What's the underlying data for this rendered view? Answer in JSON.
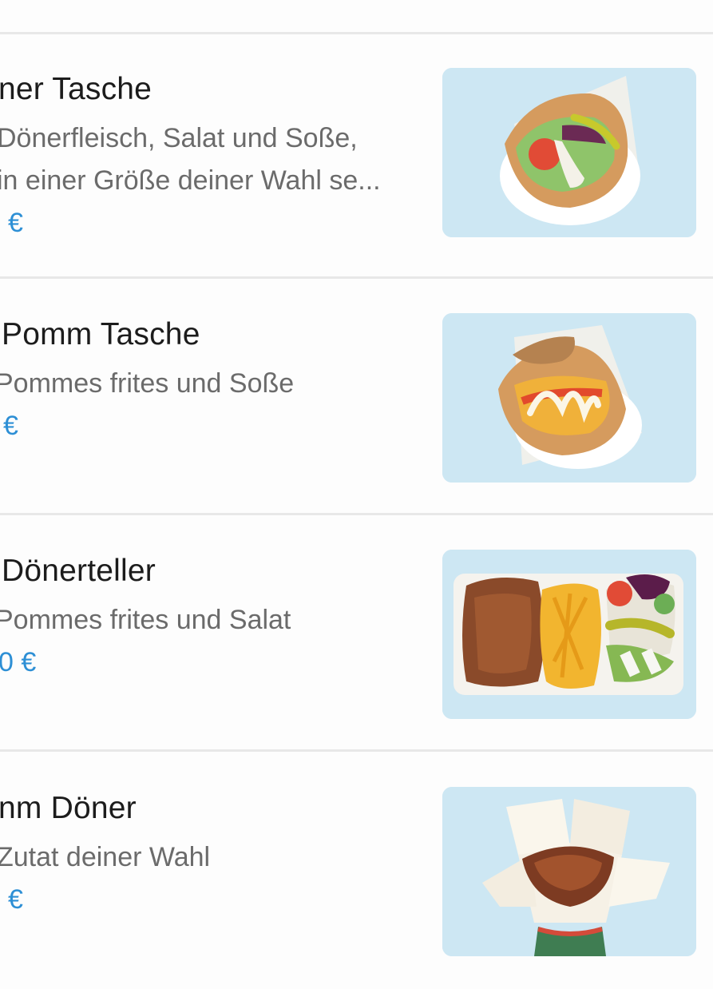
{
  "items": [
    {
      "title": "ner Tasche",
      "desc_line1": "Dönerfleisch, Salat und Soße,",
      "desc_line2": "in einer Größe deiner Wahl se...",
      "price": "€",
      "image_icon": "doener-tasche-photo"
    },
    {
      "title": "Pomm Tasche",
      "desc_line1": "Pommes frites und Soße",
      "desc_line2": "",
      "price": "€",
      "image_icon": "pomm-tasche-photo"
    },
    {
      "title": "Dönerteller",
      "desc_line1": "Pommes frites und  Salat",
      "desc_line2": "",
      "price": "0 €",
      "image_icon": "doenerteller-photo"
    },
    {
      "title": "nm Döner",
      "desc_line1": "Zutat deiner Wahl",
      "desc_line2": "",
      "price": "€",
      "image_icon": "pomm-doener-box-photo"
    }
  ],
  "colors": {
    "price": "#2d8fd5",
    "title": "#1c1c1c",
    "description": "#6b6b6b",
    "divider": "#e8e8e8",
    "thumbnail_bg": "#cde7f3"
  }
}
